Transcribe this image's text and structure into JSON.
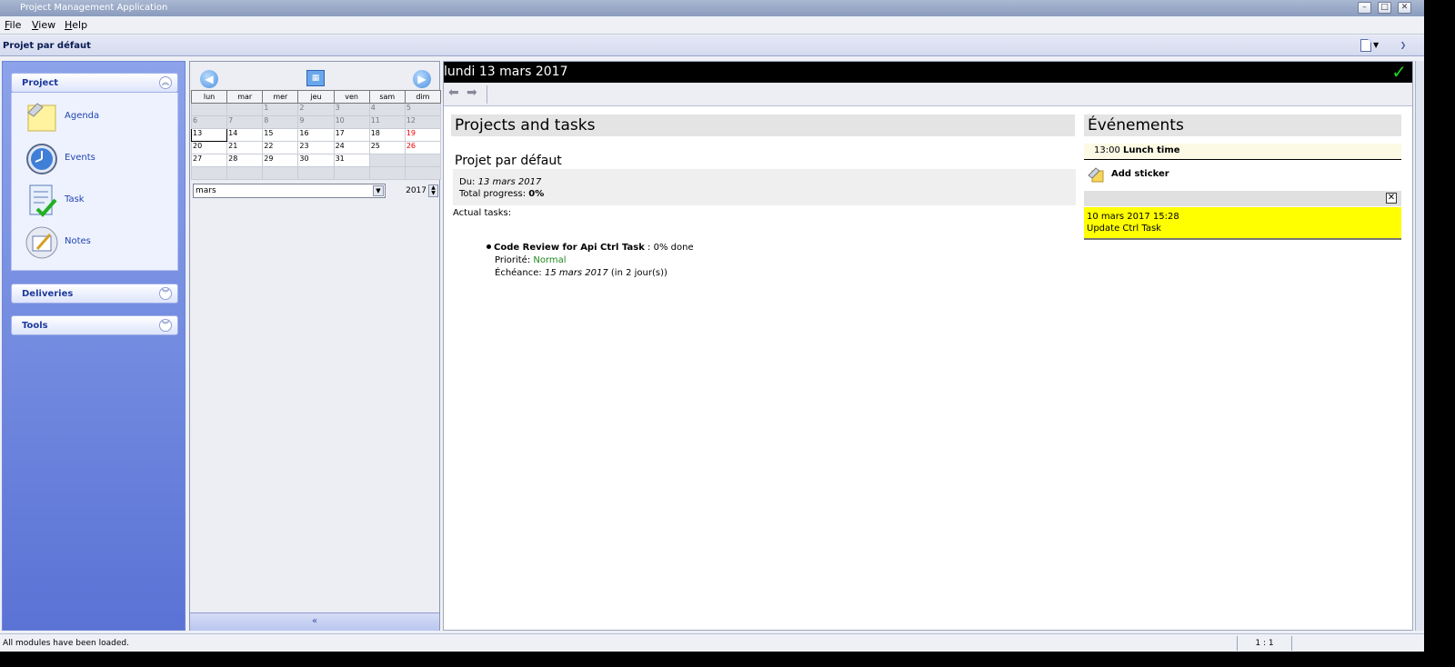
{
  "window": {
    "title": "Project Management Application",
    "buttons": [
      "–",
      "□",
      "✕"
    ]
  },
  "menubar": {
    "items": [
      "File",
      "View",
      "Help"
    ]
  },
  "projectbar": {
    "title": "Projet par défaut"
  },
  "sidebar": {
    "sections": [
      {
        "label": "Project",
        "expanded": true
      },
      {
        "label": "Deliveries",
        "expanded": false
      },
      {
        "label": "Tools",
        "expanded": false
      }
    ],
    "items": [
      {
        "label": "Agenda",
        "icon": "sticky-note-icon"
      },
      {
        "label": "Events",
        "icon": "clock-icon"
      },
      {
        "label": "Task",
        "icon": "checklist-icon"
      },
      {
        "label": "Notes",
        "icon": "notepad-icon"
      }
    ]
  },
  "calendar": {
    "weekdays": [
      "lun",
      "mar",
      "mer",
      "jeu",
      "ven",
      "sam",
      "dim"
    ],
    "weeks": [
      [
        "",
        "",
        "1",
        "2",
        "3",
        "4",
        "5"
      ],
      [
        "6",
        "7",
        "8",
        "9",
        "10",
        "11",
        "12"
      ],
      [
        "13",
        "14",
        "15",
        "16",
        "17",
        "18",
        "19"
      ],
      [
        "20",
        "21",
        "22",
        "23",
        "24",
        "25",
        "26"
      ],
      [
        "27",
        "28",
        "29",
        "30",
        "31",
        "",
        ""
      ],
      [
        "",
        "",
        "",
        "",
        "",
        "",
        ""
      ]
    ],
    "month": "mars",
    "year": "2017",
    "collapse_label": "«"
  },
  "main": {
    "date_header": "lundi 13 mars 2017",
    "projects_title": "Projects and tasks",
    "project_name": "Projet par défaut",
    "du_label": "Du:",
    "du_value": "13 mars 2017",
    "progress_label": "Total progress:",
    "progress_value": "0%",
    "actual_label": "Actual tasks:",
    "task": {
      "name": "Code Review for Api Ctrl Task",
      "progress": ": 0% done",
      "priority_label": "Priorité:",
      "priority_value": "Normal",
      "due_label": "Échéance:",
      "due_value": "15 mars 2017",
      "due_suffix": "(in 2 jour(s))"
    },
    "events_title": "Événements",
    "event": {
      "time": "13:00",
      "name": "Lunch time"
    },
    "add_sticker": "Add sticker",
    "note": {
      "close": "✕",
      "line1": "10 mars 2017 15:28",
      "line2": "Update Ctrl Task"
    }
  },
  "status": {
    "message": "All modules have been loaded.",
    "zoom": "1 : 1"
  },
  "colors": {
    "accent": "#5a73d5",
    "note": "#ffff00",
    "priority": "#1f8a1f"
  }
}
